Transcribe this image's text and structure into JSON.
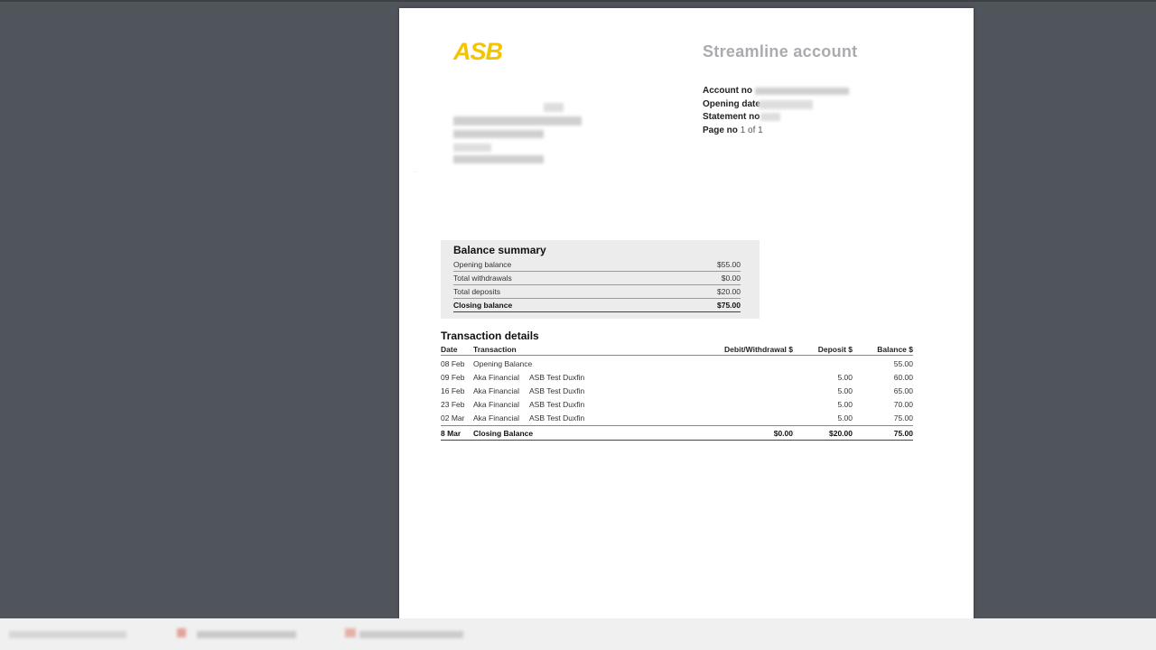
{
  "header": {
    "logo": "ASB",
    "title": "Streamline account"
  },
  "account": {
    "account_no_label": "Account no",
    "opening_date_label": "Opening date",
    "statement_no_label": "Statement no",
    "page_no_label": "Page no",
    "page_no_value": "1 of 1"
  },
  "balance_summary": {
    "title": "Balance summary",
    "rows": [
      {
        "label": "Opening balance",
        "value": "$55.00"
      },
      {
        "label": "Total withdrawals",
        "value": "$0.00"
      },
      {
        "label": "Total deposits",
        "value": "$20.00"
      },
      {
        "label": "Closing balance",
        "value": "$75.00"
      }
    ]
  },
  "transactions": {
    "title": "Transaction details",
    "columns": {
      "date": "Date",
      "transaction": "Transaction",
      "debit": "Debit/Withdrawal $",
      "deposit": "Deposit $",
      "balance": "Balance $"
    },
    "rows": [
      {
        "date": "08 Feb",
        "t1": "Opening Balance",
        "t2": "",
        "debit": "",
        "deposit": "",
        "balance": "55.00"
      },
      {
        "date": "09 Feb",
        "t1": "Aka Financial",
        "t2": "ASB Test Duxfin",
        "debit": "",
        "deposit": "5.00",
        "balance": "60.00"
      },
      {
        "date": "16 Feb",
        "t1": "Aka Financial",
        "t2": "ASB Test Duxfin",
        "debit": "",
        "deposit": "5.00",
        "balance": "65.00"
      },
      {
        "date": "23 Feb",
        "t1": "Aka Financial",
        "t2": "ASB Test Duxfin",
        "debit": "",
        "deposit": "5.00",
        "balance": "70.00"
      },
      {
        "date": "02 Mar",
        "t1": "Aka Financial",
        "t2": "ASB Test Duxfin",
        "debit": "",
        "deposit": "5.00",
        "balance": "75.00"
      }
    ],
    "closing": {
      "date": "8 Mar",
      "t1": "Closing Balance",
      "debit": "$0.00",
      "deposit": "$20.00",
      "balance": "75.00"
    }
  }
}
